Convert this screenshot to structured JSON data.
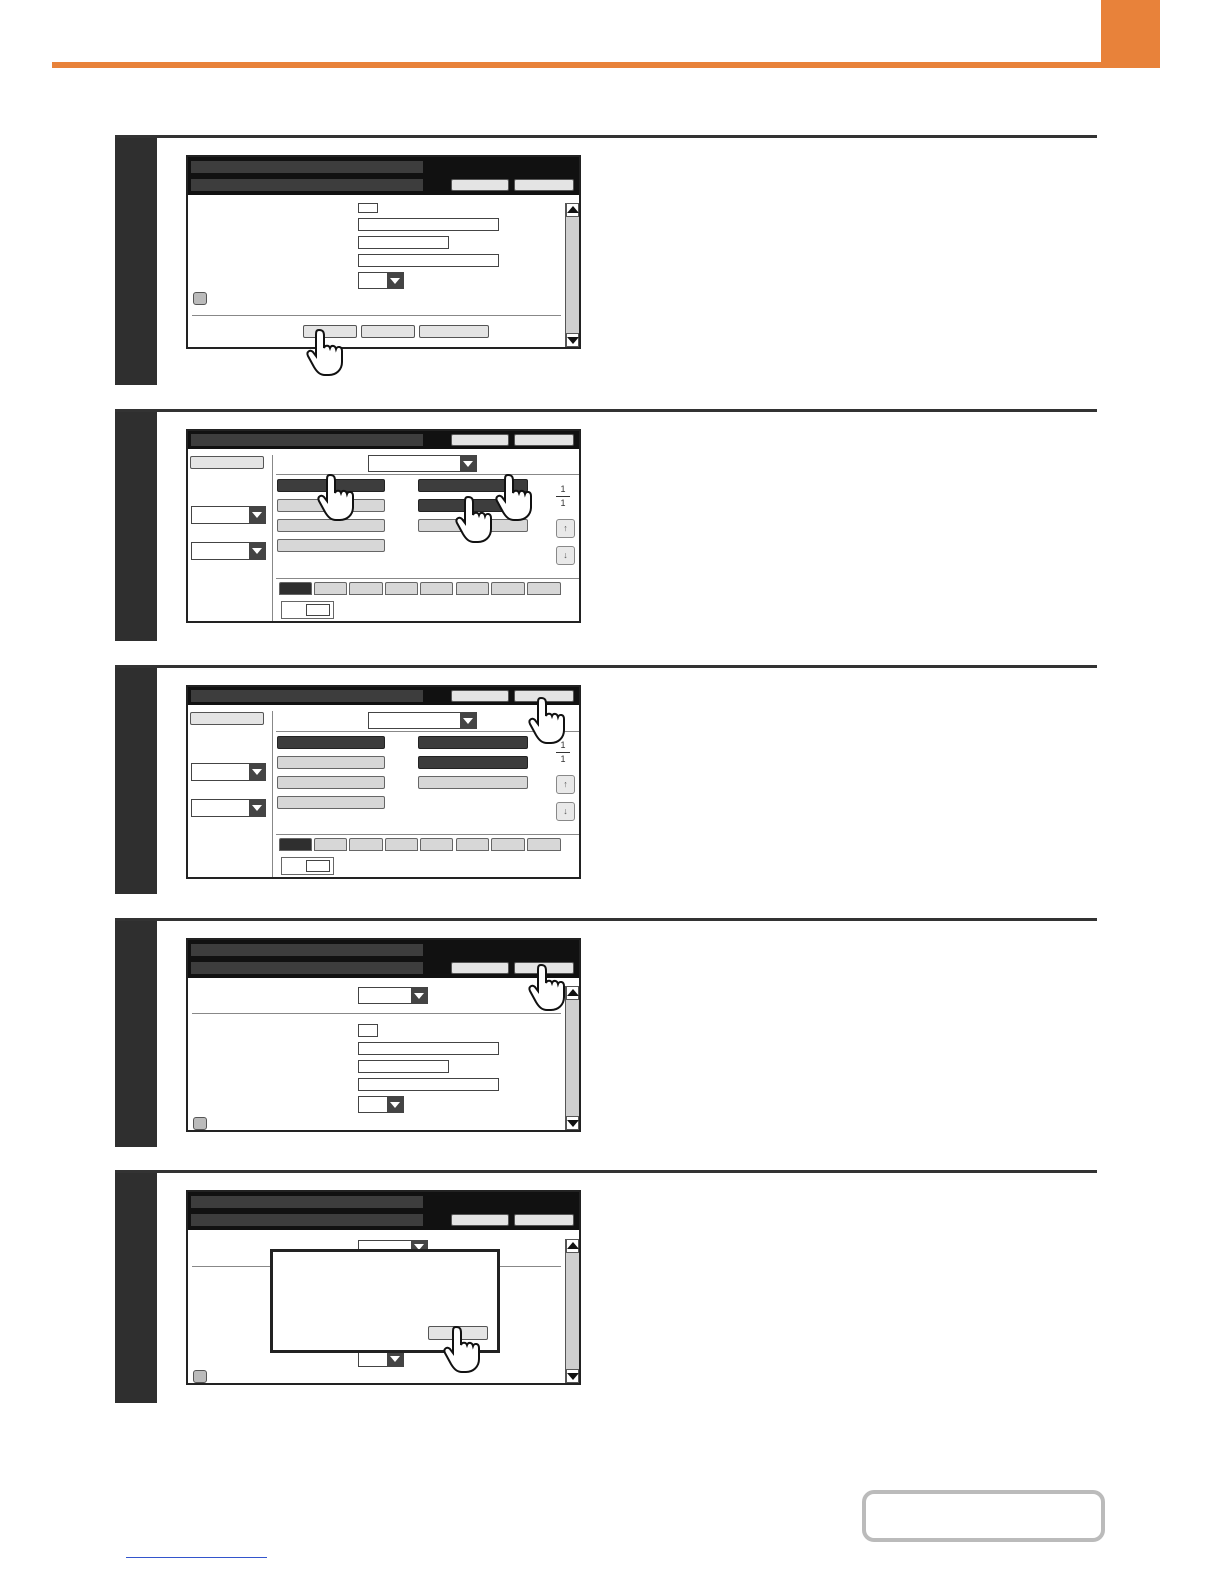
{
  "page": {
    "accent_color": "#e8823a",
    "step_bar_color": "#2f2f2f"
  },
  "steps": [
    {
      "screen": "address-registration-form",
      "hand_target": "first-bottom-button"
    },
    {
      "screen": "address-book-select",
      "hand_target": "address-keys"
    },
    {
      "screen": "address-book-select",
      "hand_target": "top-right-button"
    },
    {
      "screen": "address-registration-form-scrolled",
      "hand_target": "top-right-button"
    },
    {
      "screen": "confirmation-dialog",
      "hand_target": "dialog-ok-button"
    }
  ],
  "screen2": {
    "page_current": "1",
    "page_total": "1",
    "up_icon": "↑",
    "down_icon": "↓"
  },
  "screen3": {
    "page_current": "1",
    "page_total": "1",
    "up_icon": "↑",
    "down_icon": "↓"
  },
  "icons": {
    "hand": "pointing-hand-icon",
    "email": "envelope-icon",
    "scroll_up": "arrow-up-icon",
    "scroll_down": "arrow-down-icon"
  }
}
